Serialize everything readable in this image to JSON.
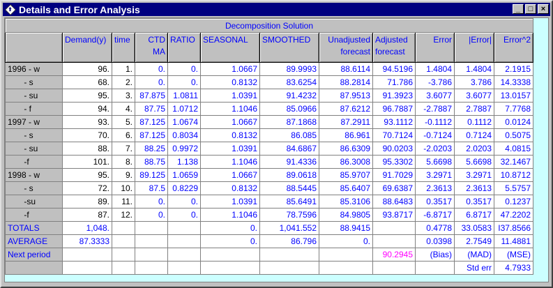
{
  "window": {
    "title": "Details and Error Analysis",
    "minimize": "_",
    "maximize": "□",
    "close": "×"
  },
  "caption": "Decomposition Solution",
  "headers": [
    "Demand(y)",
    "time",
    "CTD MA",
    "RATIO",
    "SEASONAL",
    "SMOOTHED",
    "Unadjusted forecast",
    "Adjusted forecast",
    "Error",
    "|Error|",
    "Error^2"
  ],
  "rows": [
    {
      "label": "1996 - w",
      "cells": [
        "96.",
        "1.",
        "0.",
        "0.",
        "1.0667",
        "89.9993",
        "88.6114",
        "94.5196",
        "1.4804",
        "1.4804",
        "2.1915"
      ]
    },
    {
      "label": "       - s",
      "cells": [
        "68.",
        "2.",
        "0.",
        "0.",
        "0.8132",
        "83.6254",
        "88.2814",
        "71.786",
        "-3.786",
        "3.786",
        "14.3338"
      ]
    },
    {
      "label": "       - su",
      "cells": [
        "95.",
        "3.",
        "87.875",
        "1.0811",
        "1.0391",
        "91.4232",
        "87.9513",
        "91.3923",
        "3.6077",
        "3.6077",
        "13.0157"
      ]
    },
    {
      "label": "       - f",
      "cells": [
        "94.",
        "4.",
        "87.75",
        "1.0712",
        "1.1046",
        "85.0966",
        "87.6212",
        "96.7887",
        "-2.7887",
        "2.7887",
        "7.7768"
      ]
    },
    {
      "label": "1997 - w",
      "cells": [
        "93.",
        "5.",
        "87.125",
        "1.0674",
        "1.0667",
        "87.1868",
        "87.2911",
        "93.1112",
        "-0.1112",
        "0.1112",
        "0.0124"
      ]
    },
    {
      "label": "       - s",
      "cells": [
        "70.",
        "6.",
        "87.125",
        "0.8034",
        "0.8132",
        "86.085",
        "86.961",
        "70.7124",
        "-0.7124",
        "0.7124",
        "0.5075"
      ]
    },
    {
      "label": "       - su",
      "cells": [
        "88.",
        "7.",
        "88.25",
        "0.9972",
        "1.0391",
        "84.6867",
        "86.6309",
        "90.0203",
        "-2.0203",
        "2.0203",
        "4.0815"
      ]
    },
    {
      "label": "       -f",
      "cells": [
        "101.",
        "8.",
        "88.75",
        "1.138",
        "1.1046",
        "91.4336",
        "86.3008",
        "95.3302",
        "5.6698",
        "5.6698",
        "32.1467"
      ]
    },
    {
      "label": "1998 - w",
      "cells": [
        "95.",
        "9.",
        "89.125",
        "1.0659",
        "1.0667",
        "89.0618",
        "85.9707",
        "91.7029",
        "3.2971",
        "3.2971",
        "10.8712"
      ]
    },
    {
      "label": "       - s",
      "cells": [
        "72.",
        "10.",
        "87.5",
        "0.8229",
        "0.8132",
        "88.5445",
        "85.6407",
        "69.6387",
        "2.3613",
        "2.3613",
        "5.5757"
      ]
    },
    {
      "label": "       -su",
      "cells": [
        "89.",
        "11.",
        "0.",
        "0.",
        "1.0391",
        "85.6491",
        "85.3106",
        "88.6483",
        "0.3517",
        "0.3517",
        "0.1237"
      ]
    },
    {
      "label": "       -f",
      "cells": [
        "87.",
        "12.",
        "0.",
        "0.",
        "1.1046",
        "78.7596",
        "84.9805",
        "93.8717",
        "-6.8717",
        "6.8717",
        "47.2202"
      ]
    }
  ],
  "summary": [
    {
      "label": "TOTALS",
      "cells": [
        "1,048.",
        "",
        "",
        "",
        "0.",
        "1,041.552",
        "88.9415",
        "",
        "0.4778",
        "33.0583",
        "I37.8566"
      ]
    },
    {
      "label": "AVERAGE",
      "cells": [
        "87.3333",
        "",
        "",
        "",
        "0.",
        "86.796",
        "0.",
        "",
        "0.0398",
        "2.7549",
        "11.4881"
      ]
    },
    {
      "label": "Next period",
      "cells": [
        "",
        "",
        "",
        "",
        "",
        "",
        "",
        "90.2945",
        "(Bias)",
        "(MAD)",
        "(MSE)"
      ]
    },
    {
      "label": "",
      "cells": [
        "",
        "",
        "",
        "",
        "",
        "",
        "",
        "",
        "",
        "Std err",
        "4.7933"
      ]
    }
  ]
}
